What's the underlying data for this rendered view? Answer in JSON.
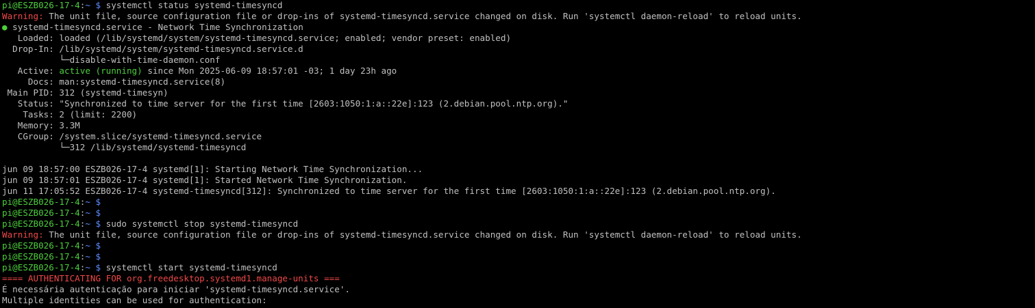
{
  "colors": {
    "background": "#000000",
    "text": "#c0c0c0",
    "prompt_user": "#4ccf3c",
    "prompt_path": "#5c8cff",
    "warning": "#f04848",
    "active_status": "#4ccf3c"
  },
  "terminal": {
    "lines": [
      [
        {
          "t": "pi@ESZB026-17-4",
          "c": "green"
        },
        {
          "t": ":",
          "c": "plain"
        },
        {
          "t": "~ $",
          "c": "blue"
        },
        {
          "t": " systemctl status systemd-timesyncd",
          "c": "plain"
        }
      ],
      [
        {
          "t": "Warning:",
          "c": "red"
        },
        {
          "t": " The unit file, source configuration file or drop-ins of systemd-timesyncd.service changed on disk. Run 'systemctl daemon-reload' to reload units.",
          "c": "plain"
        }
      ],
      [
        {
          "t": "●",
          "c": "green"
        },
        {
          "t": " systemd-timesyncd.service - Network Time Synchronization",
          "c": "plain"
        }
      ],
      [
        {
          "t": "   Loaded: loaded (/lib/systemd/system/systemd-timesyncd.service; enabled; vendor preset: enabled)",
          "c": "plain"
        }
      ],
      [
        {
          "t": "  Drop-In: /lib/systemd/system/systemd-timesyncd.service.d",
          "c": "plain"
        }
      ],
      [
        {
          "t": "           └─disable-with-time-daemon.conf",
          "c": "plain"
        }
      ],
      [
        {
          "t": "   Active: ",
          "c": "plain"
        },
        {
          "t": "active (running)",
          "c": "green"
        },
        {
          "t": " since Mon 2025-06-09 18:57:01 -03; 1 day 23h ago",
          "c": "plain"
        }
      ],
      [
        {
          "t": "     Docs: man:systemd-timesyncd.service(8)",
          "c": "plain"
        }
      ],
      [
        {
          "t": " Main PID: 312 (systemd-timesyn)",
          "c": "plain"
        }
      ],
      [
        {
          "t": "   Status: \"Synchronized to time server for the first time [2603:1050:1:a::22e]:123 (2.debian.pool.ntp.org).\"",
          "c": "plain"
        }
      ],
      [
        {
          "t": "    Tasks: 2 (limit: 2200)",
          "c": "plain"
        }
      ],
      [
        {
          "t": "   Memory: 3.3M",
          "c": "plain"
        }
      ],
      [
        {
          "t": "   CGroup: /system.slice/systemd-timesyncd.service",
          "c": "plain"
        }
      ],
      [
        {
          "t": "           └─312 /lib/systemd/systemd-timesyncd",
          "c": "plain"
        }
      ],
      [
        {
          "t": "",
          "c": "plain"
        }
      ],
      [
        {
          "t": "jun 09 18:57:00 ESZB026-17-4 systemd[1]: Starting Network Time Synchronization...",
          "c": "plain"
        }
      ],
      [
        {
          "t": "jun 09 18:57:01 ESZB026-17-4 systemd[1]: Started Network Time Synchronization.",
          "c": "plain"
        }
      ],
      [
        {
          "t": "jun 11 17:05:52 ESZB026-17-4 systemd-timesyncd[312]: Synchronized to time server for the first time [2603:1050:1:a::22e]:123 (2.debian.pool.ntp.org).",
          "c": "plain"
        }
      ],
      [
        {
          "t": "pi@ESZB026-17-4",
          "c": "green"
        },
        {
          "t": ":",
          "c": "plain"
        },
        {
          "t": "~ $",
          "c": "blue"
        }
      ],
      [
        {
          "t": "pi@ESZB026-17-4",
          "c": "green"
        },
        {
          "t": ":",
          "c": "plain"
        },
        {
          "t": "~ $",
          "c": "blue"
        }
      ],
      [
        {
          "t": "pi@ESZB026-17-4",
          "c": "green"
        },
        {
          "t": ":",
          "c": "plain"
        },
        {
          "t": "~ $",
          "c": "blue"
        },
        {
          "t": " sudo systemctl stop systemd-timesyncd",
          "c": "plain"
        }
      ],
      [
        {
          "t": "Warning:",
          "c": "red"
        },
        {
          "t": " The unit file, source configuration file or drop-ins of systemd-timesyncd.service changed on disk. Run 'systemctl daemon-reload' to reload units.",
          "c": "plain"
        }
      ],
      [
        {
          "t": "pi@ESZB026-17-4",
          "c": "green"
        },
        {
          "t": ":",
          "c": "plain"
        },
        {
          "t": "~ $",
          "c": "blue"
        }
      ],
      [
        {
          "t": "pi@ESZB026-17-4",
          "c": "green"
        },
        {
          "t": ":",
          "c": "plain"
        },
        {
          "t": "~ $",
          "c": "blue"
        }
      ],
      [
        {
          "t": "pi@ESZB026-17-4",
          "c": "green"
        },
        {
          "t": ":",
          "c": "plain"
        },
        {
          "t": "~ $",
          "c": "blue"
        },
        {
          "t": " systemctl start systemd-timesyncd",
          "c": "plain"
        }
      ],
      [
        {
          "t": "==== AUTHENTICATING FOR org.freedesktop.systemd1.manage-units ===",
          "c": "red"
        }
      ],
      [
        {
          "t": "É necessária autenticação para iniciar 'systemd-timesyncd.service'.",
          "c": "plain"
        }
      ],
      [
        {
          "t": "Multiple identities can be used for authentication:",
          "c": "plain"
        }
      ]
    ]
  }
}
